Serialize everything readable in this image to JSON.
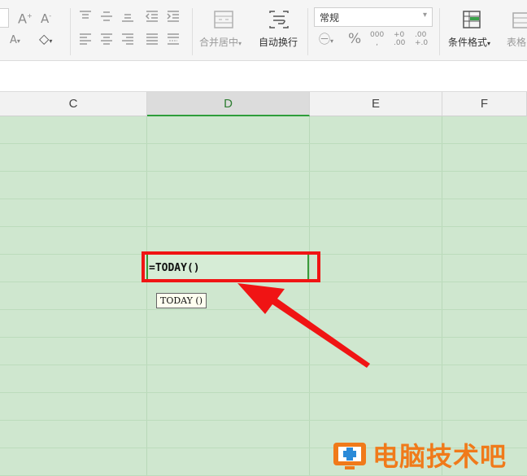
{
  "ribbon": {
    "merge_label": "合并居中",
    "wrap_label": "自动换行",
    "number_format": "常规",
    "cond_format_label": "条件格式",
    "table_style_label": "表格"
  },
  "columns": [
    "C",
    "D",
    "E",
    "F"
  ],
  "active_column": "D",
  "cell_formula": "=TODAY()",
  "tooltip": "TODAY ()",
  "watermark": "电脑技术吧",
  "colors": {
    "grid_bg": "#cfe7cf",
    "highlight_red": "#f01414",
    "active_green": "#2e9d3a",
    "watermark_orange": "#f07a1a"
  }
}
